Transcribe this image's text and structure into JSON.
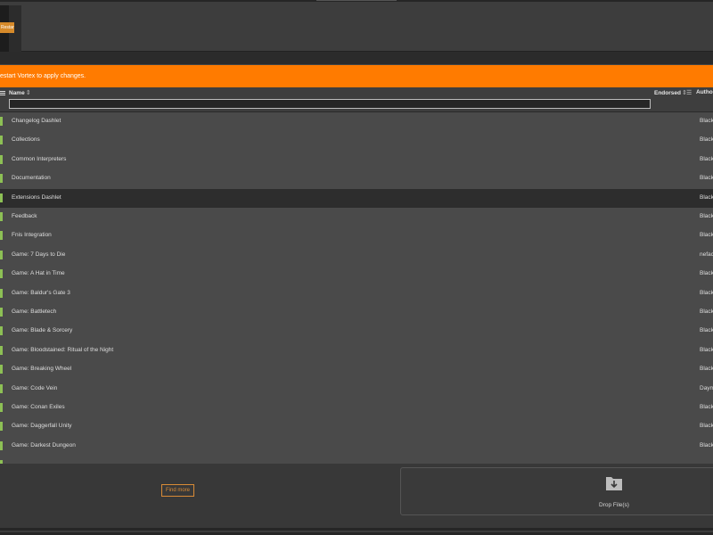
{
  "header": {
    "thumbnail_button_label": "Restart"
  },
  "banner": {
    "message": "estart Vortex to apply changes."
  },
  "table": {
    "columns": {
      "name": "Name",
      "endorsed": "Endorsed",
      "author": "Autho"
    },
    "sort_glyph": "⇕",
    "filter_glyph": "☰",
    "name_filter_value": "",
    "rows": [
      {
        "name": "Changelog Dashlet",
        "author": "Black",
        "selected": false
      },
      {
        "name": "Collections",
        "author": "Black",
        "selected": false
      },
      {
        "name": "Common Interpreters",
        "author": "Black",
        "selected": false
      },
      {
        "name": "Documentation",
        "author": "Black",
        "selected": false
      },
      {
        "name": "Extensions Dashlet",
        "author": "Black",
        "selected": true
      },
      {
        "name": "Feedback",
        "author": "Black",
        "selected": false
      },
      {
        "name": "Fnis Integration",
        "author": "Black",
        "selected": false
      },
      {
        "name": "Game: 7 Days to Die",
        "author": "nefac",
        "selected": false
      },
      {
        "name": "Game: A Hat in Time",
        "author": "Black",
        "selected": false
      },
      {
        "name": "Game: Baldur's Gate 3",
        "author": "Black",
        "selected": false
      },
      {
        "name": "Game: Battletech",
        "author": "Black",
        "selected": false
      },
      {
        "name": "Game: Blade & Sorcery",
        "author": "Black",
        "selected": false
      },
      {
        "name": "Game: Bloodstained: Ritual of the Night",
        "author": "Black",
        "selected": false
      },
      {
        "name": "Game: Breaking Wheel",
        "author": "Black",
        "selected": false
      },
      {
        "name": "Game: Code Vein",
        "author": "Daym",
        "selected": false
      },
      {
        "name": "Game: Conan Exiles",
        "author": "Black",
        "selected": false
      },
      {
        "name": "Game: Daggerfall Unity",
        "author": "Black",
        "selected": false
      },
      {
        "name": "Game: Darkest Dungeon",
        "author": "Black",
        "selected": false
      }
    ]
  },
  "footer": {
    "find_more_label": "Find more",
    "drop_label": "Drop File(s)"
  },
  "colors": {
    "accent": "#ff7b00",
    "enabled_status": "#8dc055",
    "find_more_border": "#d98b36"
  },
  "icons": {
    "columns_menu": "menu-icon",
    "sort": "sort-icon",
    "column_filter": "filter-list-icon",
    "drop": "folder-download-icon"
  }
}
